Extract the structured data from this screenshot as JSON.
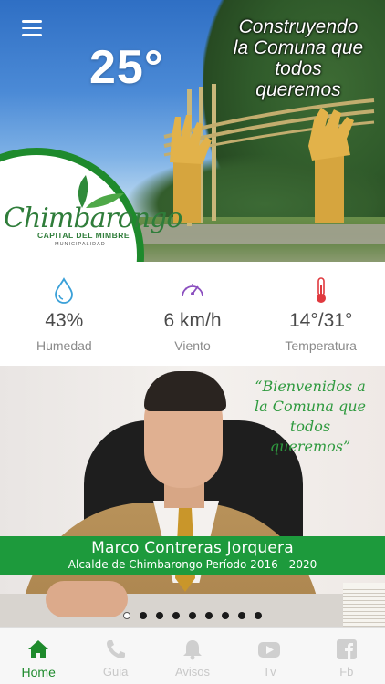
{
  "header": {
    "temperature": "25°",
    "slogan": "Construyendo la Comuna que todos queremos",
    "logo": {
      "name": "Chimbarongo",
      "subtitle": "CAPITAL DEL MIMBRE",
      "tagline": "MUNICIPALIDAD"
    }
  },
  "weather": [
    {
      "icon": "water-drop-icon",
      "value": "43%",
      "label": "Humedad"
    },
    {
      "icon": "speedometer-icon",
      "value": "6 km/h",
      "label": "Viento"
    },
    {
      "icon": "thermometer-icon",
      "value": "14°/31°",
      "label": "Temperatura"
    }
  ],
  "banner": {
    "welcome": "“Bienvenidos a la Comuna que todos queremos”",
    "mayor_name": "Marco Contreras Jorquera",
    "mayor_title": "Alcalde de Chimbarongo Período 2016 - 2020",
    "slides_total": 9,
    "active_slide": 1
  },
  "tabs": [
    {
      "label": "Home",
      "icon": "home-icon",
      "active": true
    },
    {
      "label": "Guia",
      "icon": "phone-icon",
      "active": false
    },
    {
      "label": "Avisos",
      "icon": "bell-icon",
      "active": false
    },
    {
      "label": "Tv",
      "icon": "youtube-icon",
      "active": false
    },
    {
      "label": "Fb",
      "icon": "facebook-icon",
      "active": false
    }
  ],
  "colors": {
    "brand_green": "#1e8a2c",
    "band_green": "#1d9a3c",
    "drop_blue": "#3aa0d8",
    "gauge_purple": "#8b4fbf",
    "thermo_red": "#e0393e"
  }
}
